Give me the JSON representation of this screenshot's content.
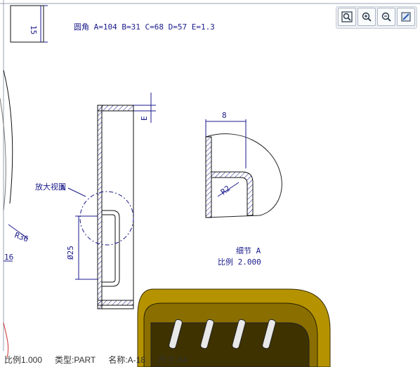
{
  "header_note": "圆角 A=104  B=31  C=68  D=57  E=1.3",
  "dims": {
    "top_box": "15",
    "left_r": "R36",
    "left_16": "16",
    "diameter": "Ø25",
    "e_label": "E",
    "detail_width": "8",
    "detail_radius": "R2"
  },
  "detail_view": {
    "callout_prefix": "放大视图",
    "callout_letter": "A",
    "caption_line1": "细节  A",
    "caption_line2": "比例 2.000"
  },
  "toolbar": {
    "buttons": [
      {
        "name": "fit-view-icon"
      },
      {
        "name": "zoom-in-icon"
      },
      {
        "name": "zoom-out-icon"
      },
      {
        "name": "edit-sheet-icon"
      }
    ]
  },
  "status": {
    "scale": "比例1.000",
    "type": "类型:PART",
    "name": "名称:A-18",
    "size": "尺寸:A4"
  },
  "colors": {
    "line": "#1a1a8c",
    "hatch": "#1a1a8c",
    "model_gold": "#b59300"
  }
}
